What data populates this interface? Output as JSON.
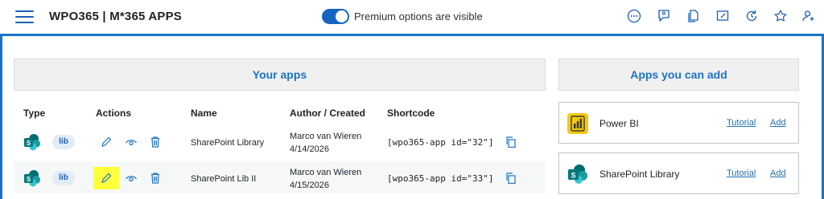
{
  "header": {
    "title": "WPO365 | M*365 APPS",
    "premium_toggle_label": "Premium options are visible",
    "premium_toggle_on": true,
    "icons": [
      "more-options-icon",
      "user-voice-icon",
      "docs-icon",
      "feedback-icon",
      "refresh-icon",
      "star-icon",
      "user-add-icon"
    ]
  },
  "your_apps": {
    "title": "Your apps",
    "columns": [
      "Type",
      "Actions",
      "Name",
      "Author / Created",
      "Shortcode"
    ],
    "rows": [
      {
        "type_badge": "lib",
        "name": "SharePoint Library",
        "author": "Marco van Wieren",
        "created": "4/14/2026",
        "shortcode": "[wpo365-app id=\"32\"]",
        "edit_highlighted": false
      },
      {
        "type_badge": "lib",
        "name": "SharePoint Lib II",
        "author": "Marco van Wieren",
        "created": "4/15/2026",
        "shortcode": "[wpo365-app id=\"33\"]",
        "edit_highlighted": true
      }
    ]
  },
  "apps_you_can_add": {
    "title": "Apps you can add",
    "items": [
      {
        "name": "Power BI",
        "tutorial": "Tutorial",
        "add": "Add"
      },
      {
        "name": "SharePoint Library",
        "tutorial": "Tutorial",
        "add": "Add"
      }
    ]
  },
  "colors": {
    "accent": "#1a73c7",
    "highlight": "#ffff3c",
    "powerbi": "#f2c811",
    "sharepoint": "#038387"
  }
}
